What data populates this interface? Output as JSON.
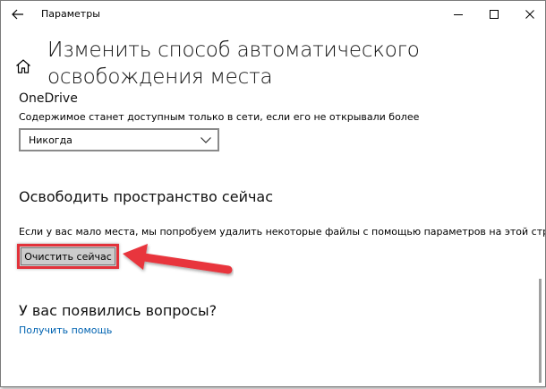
{
  "window": {
    "title": "Параметры"
  },
  "header": {
    "title": "Изменить способ автоматического освобождения места"
  },
  "onedrive": {
    "title": "OneDrive",
    "description": "Содержимое станет доступным только в сети, если его не открывали более",
    "dropdown_value": "Никогда"
  },
  "free_space": {
    "title": "Освободить пространство сейчас",
    "description": "Если у вас мало места, мы попробуем удалить некоторые файлы с помощью параметров на этой странице.",
    "button_label": "Очистить сейчас"
  },
  "help": {
    "title": "У вас появились вопросы?",
    "link": "Получить помощь"
  },
  "colors": {
    "accent_link": "#0063b1",
    "highlight_red": "#e2323a",
    "button_bg": "#cccccc"
  },
  "icons": {
    "back": "arrow-left-icon",
    "minimize": "minimize-icon",
    "maximize": "maximize-icon",
    "close": "close-icon",
    "home": "home-icon",
    "dropdown": "chevron-down-icon",
    "annotation": "red-arrow-annotation"
  }
}
